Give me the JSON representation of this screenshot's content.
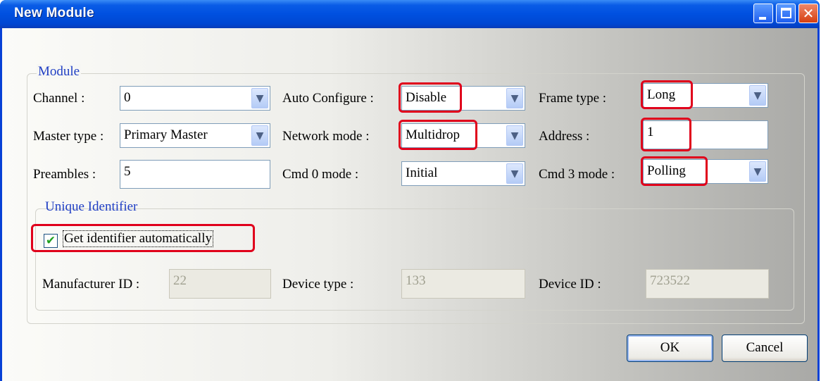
{
  "window": {
    "title": "New Module"
  },
  "module_group": {
    "legend": "Module",
    "channel": {
      "label": "Channel :",
      "value": "0"
    },
    "auto_configure": {
      "label": "Auto Configure :",
      "value": "Disable"
    },
    "frame_type": {
      "label": "Frame type :",
      "value": "Long"
    },
    "master_type": {
      "label": "Master type :",
      "value": "Primary Master"
    },
    "network_mode": {
      "label": "Network mode :",
      "value": "Multidrop"
    },
    "address": {
      "label": "Address :",
      "value": "1"
    },
    "preambles": {
      "label": "Preambles :",
      "value": "5"
    },
    "cmd0_mode": {
      "label": "Cmd 0 mode :",
      "value": "Initial"
    },
    "cmd3_mode": {
      "label": "Cmd 3 mode :",
      "value": "Polling"
    }
  },
  "identifier_group": {
    "legend": "Unique Identifier",
    "get_auto": {
      "label": "Get identifier automatically",
      "checked": true
    },
    "manufacturer_id": {
      "label": "Manufacturer ID :",
      "value": "22"
    },
    "device_type": {
      "label": "Device type :",
      "value": "133"
    },
    "device_id": {
      "label": "Device ID :",
      "value": "723522"
    }
  },
  "buttons": {
    "ok": "OK",
    "cancel": "Cancel"
  },
  "colors": {
    "title_bar": "#0050e0",
    "legend_text": "#1f3ec4",
    "highlight": "#e0001b",
    "check": "#21a121"
  },
  "icons": {
    "minimize": "minimize-icon",
    "maximize": "maximize-icon",
    "close": "close-icon",
    "dropdown": "chevron-down-icon",
    "check": "check-icon"
  }
}
